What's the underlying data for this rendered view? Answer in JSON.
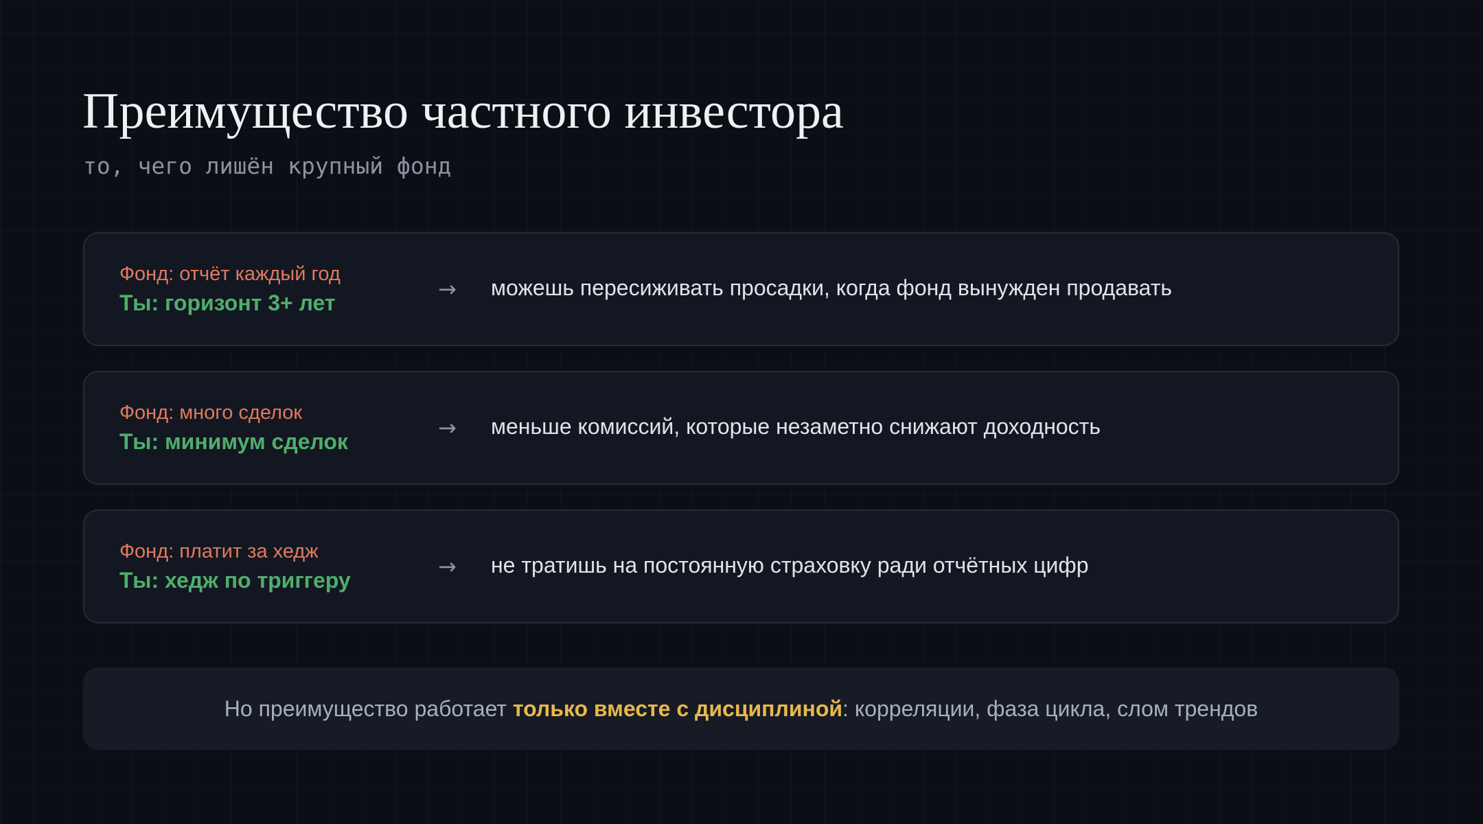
{
  "title": "Преимущество частного инвестора",
  "subtitle": "то, чего лишён крупный фонд",
  "rows": [
    {
      "fund": "Фонд: отчёт каждый год",
      "you": "Ты: горизонт 3+ лет",
      "arrow": "→",
      "benefit": "можешь пересиживать просадки, когда фонд вынужден продавать"
    },
    {
      "fund": "Фонд: много сделок",
      "you": "Ты: минимум сделок",
      "arrow": "→",
      "benefit": "меньше комиссий, которые незаметно снижают доходность"
    },
    {
      "fund": "Фонд: платит за хедж",
      "you": "Ты: хедж по триггеру",
      "arrow": "→",
      "benefit": "не тратишь на постоянную страховку ради отчётных цифр"
    }
  ],
  "footer": {
    "before": "Но преимущество работает ",
    "highlight": "только вместе с дисциплиной",
    "after": ": корреляции, фаза цикла, слом трендов"
  },
  "colors": {
    "background": "#0b0e14",
    "card": "#131721",
    "fund_text": "#e07a5f",
    "you_text": "#4fae6c",
    "highlight": "#e8b84a"
  }
}
